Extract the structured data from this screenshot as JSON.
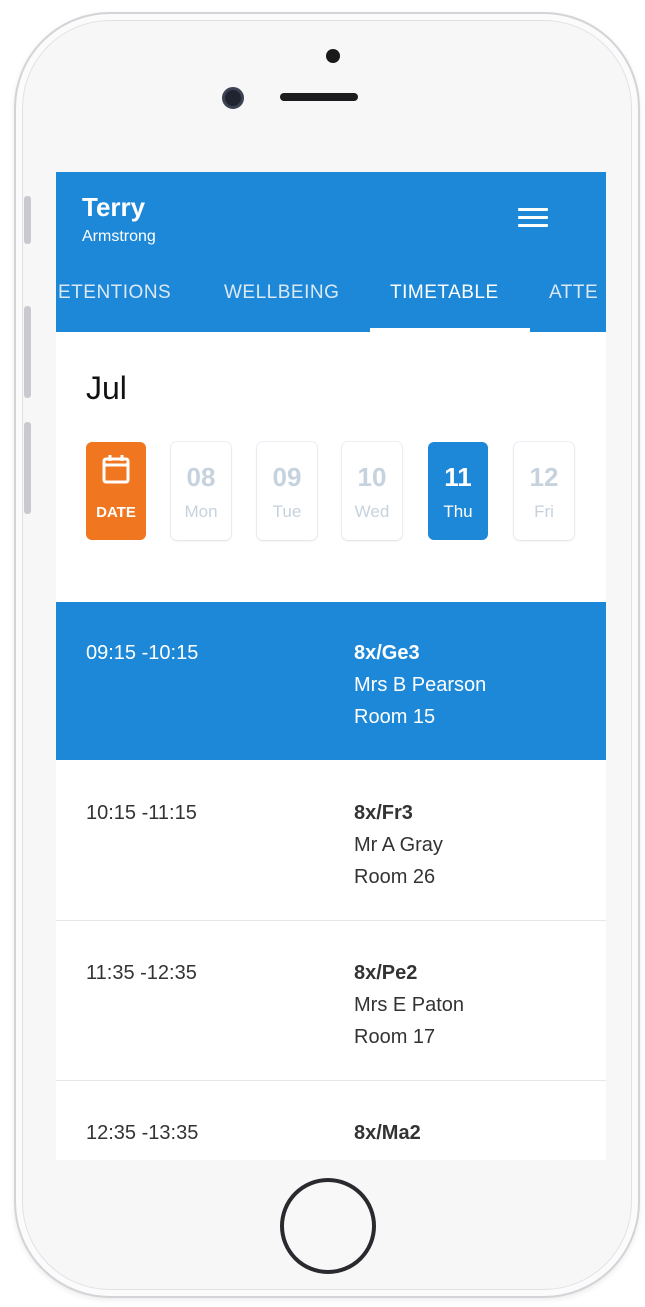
{
  "user": {
    "first_name": "Terry",
    "last_name": "Armstrong"
  },
  "tabs": [
    {
      "label": "ETENTIONS"
    },
    {
      "label": "WELLBEING"
    },
    {
      "label": "TIMETABLE"
    },
    {
      "label": "ATTE"
    }
  ],
  "active_tab": "TIMETABLE",
  "month": "Jul",
  "date_button": {
    "label": "DATE"
  },
  "days": [
    {
      "num": "08",
      "name": "Mon"
    },
    {
      "num": "09",
      "name": "Tue"
    },
    {
      "num": "10",
      "name": "Wed"
    },
    {
      "num": "11",
      "name": "Thu"
    },
    {
      "num": "12",
      "name": "Fri"
    }
  ],
  "active_day": "11",
  "lessons": [
    {
      "time": "09:15 -10:15",
      "class": "8x/Ge3",
      "teacher": "Mrs B Pearson",
      "room": "Room 15"
    },
    {
      "time": "10:15 -11:15",
      "class": "8x/Fr3",
      "teacher": "Mr A Gray",
      "room": "Room 26"
    },
    {
      "time": "11:35 -12:35",
      "class": "8x/Pe2",
      "teacher": "Mrs E Paton",
      "room": "Room 17"
    },
    {
      "time": "12:35 -13:35",
      "class": "8x/Ma2",
      "teacher": "",
      "room": ""
    }
  ],
  "colors": {
    "primary": "#1e88d8",
    "date_accent": "#f0761f"
  }
}
